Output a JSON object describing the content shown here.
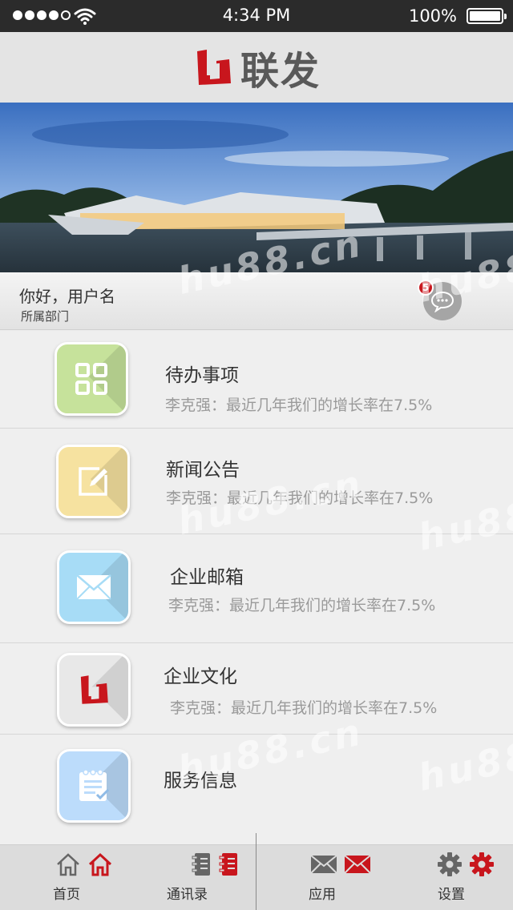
{
  "status_bar": {
    "time": "4:34 PM",
    "battery": "100%",
    "signal_bars": 5,
    "signal_filled": 4
  },
  "header": {
    "brand": "联发",
    "logo_icon": "lianfa-logo-icon",
    "brand_color": "#c8161d"
  },
  "user": {
    "greeting": "你好，用户名",
    "department": "所属部门",
    "message_badge": "5",
    "message_icon": "chat-bubble-icon"
  },
  "menu_items": [
    {
      "title": "待办事项",
      "subtitle": "李克强：最近几年我们的增长率在7.5%",
      "icon": "grid-icon",
      "color": "#c6e29b"
    },
    {
      "title": "新闻公告",
      "subtitle": "李克强：最近几年我们的增长率在7.5%",
      "icon": "edit-icon",
      "color": "#f6e2a0"
    },
    {
      "title": "企业邮箱",
      "subtitle": "李克强：最近几年我们的增长率在7.5%",
      "icon": "mail-icon",
      "color": "#a7dcf6"
    },
    {
      "title": "企业文化",
      "subtitle": "李克强：最近几年我们的增长率在7.5%",
      "icon": "lianfa-logo-icon",
      "color": "#e8e8e8"
    },
    {
      "title": "服务信息",
      "subtitle": "",
      "icon": "notepad-icon",
      "color": "#bcdcfb"
    }
  ],
  "watermark": "hu88.cn",
  "tab_bar": [
    {
      "label": "首页",
      "icon": "home-icon"
    },
    {
      "label": "通讯录",
      "icon": "contacts-book-icon"
    },
    {
      "label": "应用",
      "icon": "mail-icon"
    },
    {
      "label": "设置",
      "icon": "gear-icon"
    }
  ]
}
